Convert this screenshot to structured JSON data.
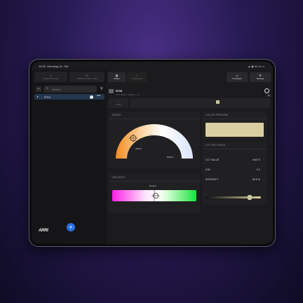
{
  "status": {
    "time": "16:05",
    "date": "Dienstag 16. Okt.",
    "battery": "41 %"
  },
  "sidebar": {
    "top_buttons": [
      {
        "label": "Search Fixtures"
      },
      {
        "label": "Identify Fixtures · Edit"
      }
    ],
    "search_placeholder": "Search",
    "fixtures": [
      {
        "name": "RTIS"
      }
    ],
    "brand": "ARRI"
  },
  "toolbar": {
    "status_label": "Status",
    "other_label": "Configuration",
    "feedback_label": "Feedback",
    "settings_label": "Settings"
  },
  "fixture": {
    "name": "RTIS",
    "subtitle": "CCT Mode · Lighting · ca"
  },
  "modes": [
    {
      "label": "Mode"
    },
    {
      "label": ""
    }
  ],
  "scale": {
    "title": "SCALE",
    "ticks": [
      "3000 K",
      "5600 K",
      "8000 K"
    ],
    "gradient": [
      "#f58a1e",
      "#fbd7a8",
      "#ffffff",
      "#d9e4ff"
    ]
  },
  "gm_shift": {
    "title": "GM SHIFT",
    "neutral_label": "Neutral"
  },
  "color_preview": {
    "title": "COLOR PREVIEW",
    "color": "#d9cfa2"
  },
  "cct_settings": {
    "title": "CCT SETTINGS",
    "rows": [
      {
        "label": "CCT VALUE",
        "value": "4447 K"
      },
      {
        "label": "G/M",
        "value": "0.1"
      },
      {
        "label": "INTENSITY",
        "value": "82.8 %"
      }
    ],
    "intensity_fraction": 0.83
  }
}
